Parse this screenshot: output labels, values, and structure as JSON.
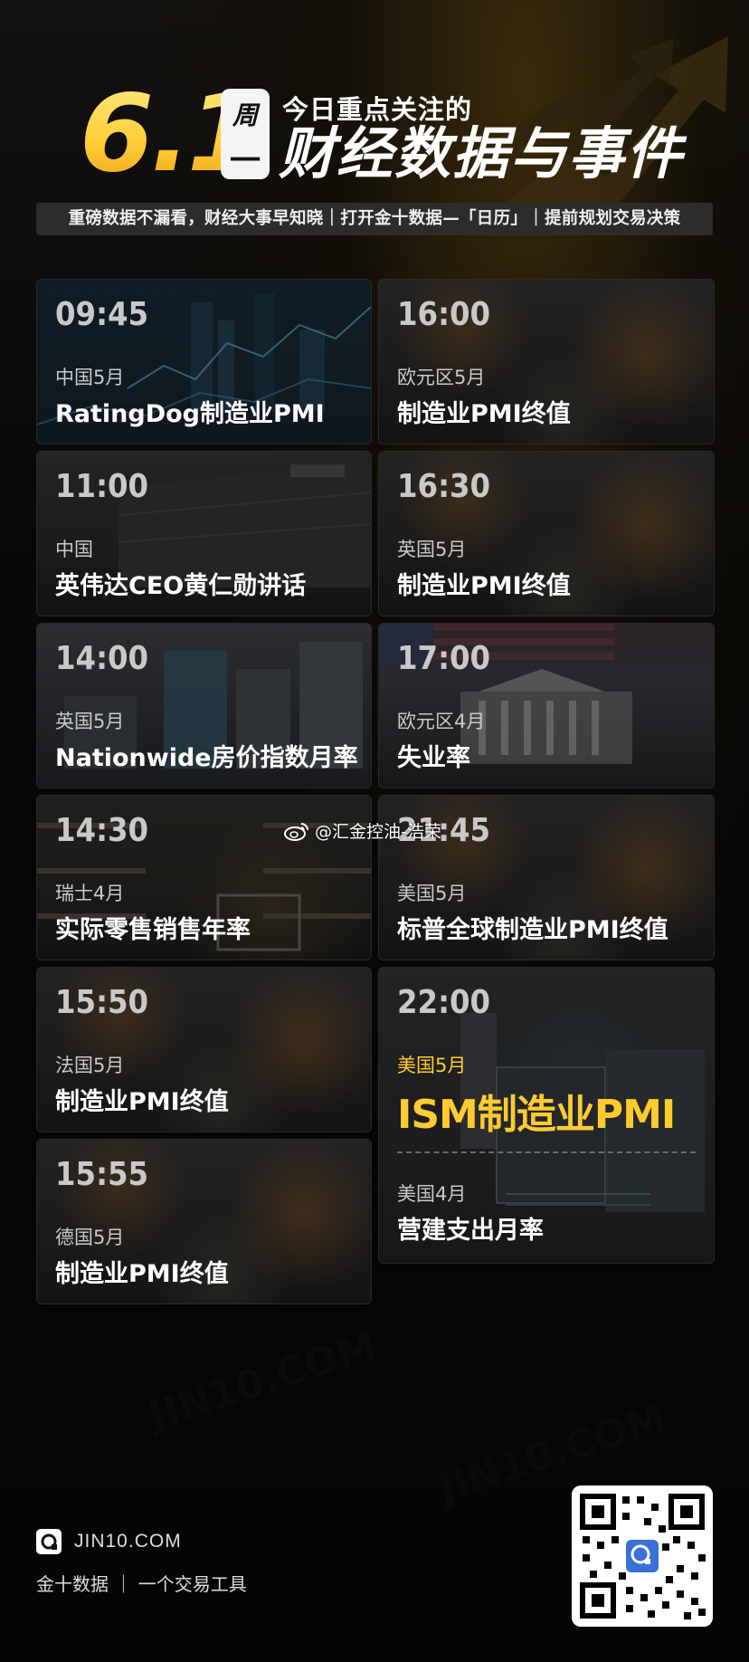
{
  "header": {
    "date": "6.1",
    "weekday_top": "周",
    "weekday_bottom": "一",
    "subtitle": "今日重点关注的",
    "title": "财经数据与事件",
    "tagline": "重磅数据不漏看，财经大事早知晓｜打开金十数据—「日历」｜提前规划交易决策"
  },
  "events": [
    {
      "time": "09:45",
      "region": "中国5月",
      "event": "RatingDog制造业PMI"
    },
    {
      "time": "16:00",
      "region": "欧元区5月",
      "event": "制造业PMI终值"
    },
    {
      "time": "11:00",
      "region": "中国",
      "event": "英伟达CEO黄仁勋讲话"
    },
    {
      "time": "16:30",
      "region": "英国5月",
      "event": "制造业PMI终值"
    },
    {
      "time": "14:00",
      "region": "英国5月",
      "event": "Nationwide房价指数月率"
    },
    {
      "time": "17:00",
      "region": "欧元区4月",
      "event": "失业率"
    },
    {
      "time": "14:30",
      "region": "瑞士4月",
      "event": "实际零售销售年率"
    },
    {
      "time": "21:45",
      "region": "美国5月",
      "event": "标普全球制造业PMI终值"
    },
    {
      "time": "15:50",
      "region": "法国5月",
      "event": "制造业PMI终值"
    },
    {
      "time": "15:55",
      "region": "德国5月",
      "event": "制造业PMI终值"
    }
  ],
  "highlight": {
    "time": "22:00",
    "region": "美国5月",
    "event": "ISM制造业PMI",
    "region2": "美国4月",
    "event2": "营建支出月率"
  },
  "watermark": "@汇金控油-浩荣",
  "footer": {
    "site": "JIN10.COM",
    "brand": "金十数据  ｜  一个交易工具"
  },
  "colors": {
    "accent": "#ffcb2e",
    "background": "#060606",
    "tagline_bg": "#2d2c2a"
  }
}
